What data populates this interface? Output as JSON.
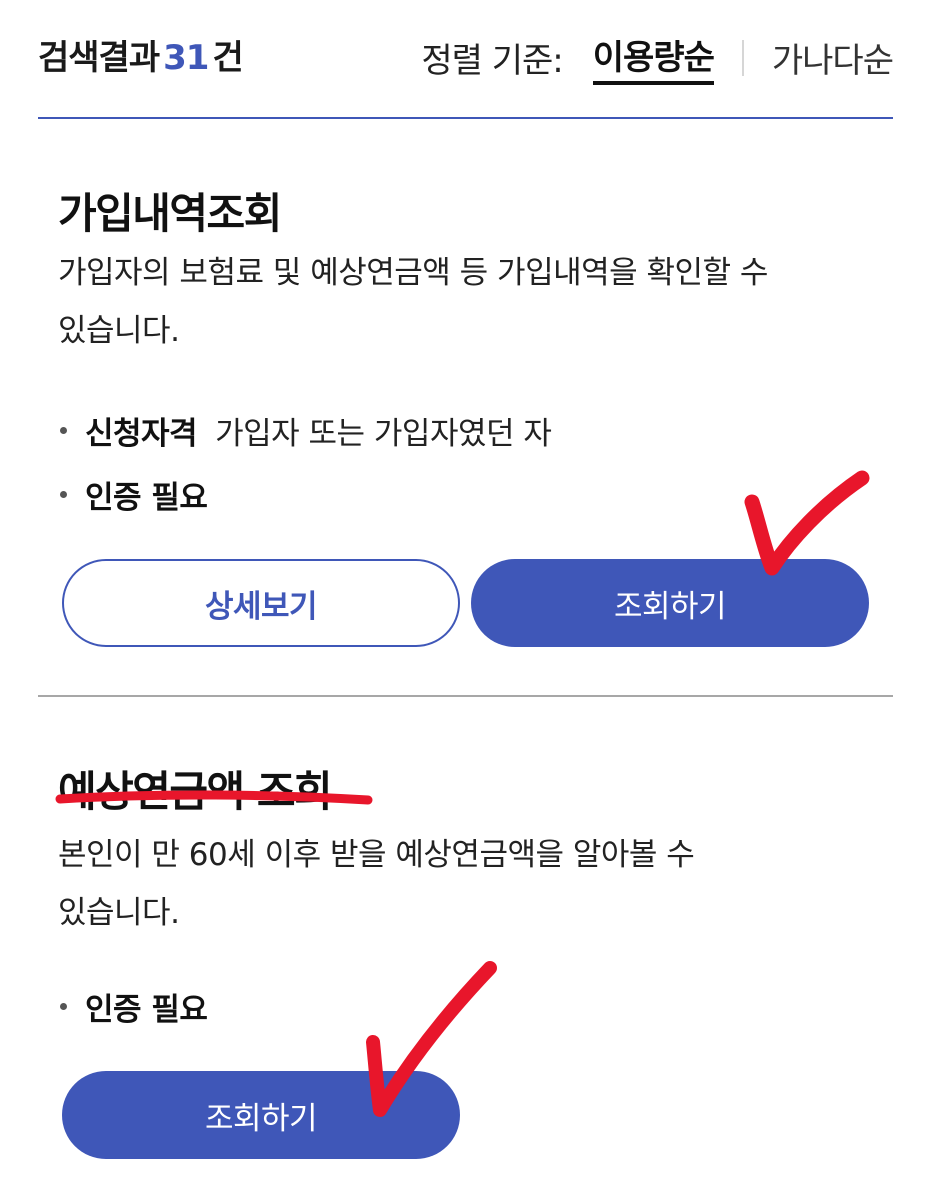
{
  "header": {
    "result_prefix": "검색결과",
    "result_count": "31",
    "result_suffix": "건",
    "sort_label": "정렬 기준:",
    "sort_options": [
      {
        "label": "이용량순",
        "active": true
      },
      {
        "label": "가나다순",
        "active": false
      }
    ]
  },
  "cards": [
    {
      "title": "가입내역조회",
      "description_lines": [
        "가입자의 보험료 및 예상연금액 등 가입내역을 확인할 수",
        "있습니다."
      ],
      "bullets": [
        {
          "key": "신청자격",
          "value": "가입자 또는 가입자였던 자"
        },
        {
          "key": "인증 필요",
          "value": ""
        }
      ],
      "buttons": [
        {
          "label": "상세보기",
          "style": "outline"
        },
        {
          "label": "조회하기",
          "style": "primary"
        }
      ]
    },
    {
      "title": "예상연금액 조회",
      "description_lines": [
        "본인이 만 60세 이후 받을 예상연금액을 알아볼 수",
        "있습니다."
      ],
      "bullets": [
        {
          "key": "인증 필요",
          "value": ""
        }
      ],
      "buttons": [
        {
          "label": "조회하기",
          "style": "primary"
        }
      ]
    }
  ],
  "colors": {
    "primary": "#3f57b8",
    "annotation": "#e8162b",
    "text": "#111111",
    "divider": "#a7a7a7"
  }
}
